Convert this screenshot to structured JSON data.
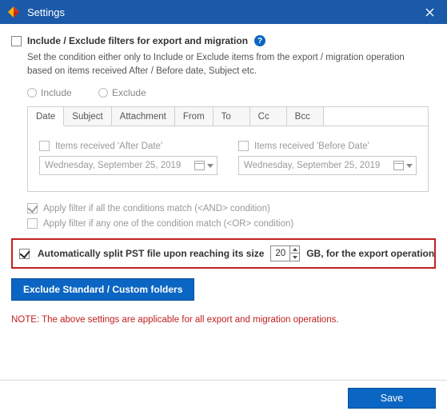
{
  "window": {
    "title": "Settings"
  },
  "filters": {
    "heading": "Include / Exclude filters for export and migration",
    "description": "Set the condition either only to Include or Exclude items from the export / migration operation based on items received After / Before date, Subject etc.",
    "include_label": "Include",
    "exclude_label": "Exclude"
  },
  "tabs": {
    "date": "Date",
    "subject": "Subject",
    "attachment": "Attachment",
    "from": "From",
    "to": "To",
    "cc": "Cc",
    "bcc": "Bcc"
  },
  "date_panel": {
    "after_label": "Items received 'After Date'",
    "before_label": "Items received 'Before Date'",
    "after_value": "Wednesday, September 25, 2019",
    "before_value": "Wednesday, September 25, 2019"
  },
  "conditions": {
    "and_label": "Apply filter if all the conditions match (<AND> condition)",
    "or_label": "Apply filter if any one of the condition match (<OR> condition)"
  },
  "split": {
    "prefix": "Automatically split PST file upon reaching its size",
    "value": "20",
    "suffix": "GB, for the export operation"
  },
  "exclude_button": "Exclude Standard / Custom folders",
  "note": "NOTE: The above settings are applicable for all export and migration operations.",
  "save": "Save"
}
